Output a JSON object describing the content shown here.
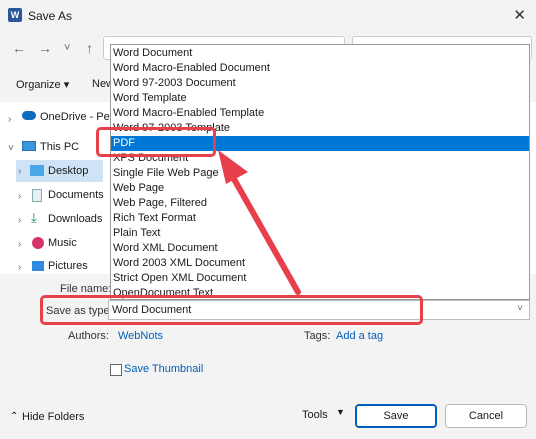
{
  "window": {
    "title": "Save As"
  },
  "nav": {
    "back": "←",
    "forward": "→",
    "recent": "˅",
    "up": "↑"
  },
  "toolbar": {
    "organize": "Organize ▾",
    "new_folder": "New"
  },
  "sidebar": {
    "onedrive": "OneDrive - Pers",
    "this_pc": "This PC",
    "items": [
      "Desktop",
      "Documents",
      "Downloads",
      "Music",
      "Pictures"
    ]
  },
  "form": {
    "file_name_label": "File name:",
    "save_as_type_label": "Save as type:",
    "save_as_type_value": "Word Document",
    "authors_label": "Authors:",
    "authors_value": "WebNots",
    "tags_label": "Tags:",
    "tags_value": "Add a tag",
    "save_thumbnail": "Save Thumbnail"
  },
  "footer": {
    "hide_folders": "Hide Folders",
    "tools": "Tools",
    "save": "Save",
    "cancel": "Cancel"
  },
  "dropdown": {
    "items": [
      "Word Document",
      "Word Macro-Enabled Document",
      "Word 97-2003 Document",
      "Word Template",
      "Word Macro-Enabled Template",
      "Word 97-2003 Template",
      "PDF",
      "XPS Document",
      "Single File Web Page",
      "Web Page",
      "Web Page, Filtered",
      "Rich Text Format",
      "Plain Text",
      "Word XML Document",
      "Word 2003 XML Document",
      "Strict Open XML Document",
      "OpenDocument Text"
    ],
    "selected": "PDF"
  },
  "colors": {
    "highlight": "#0078d7",
    "annotation": "#e8404b"
  }
}
